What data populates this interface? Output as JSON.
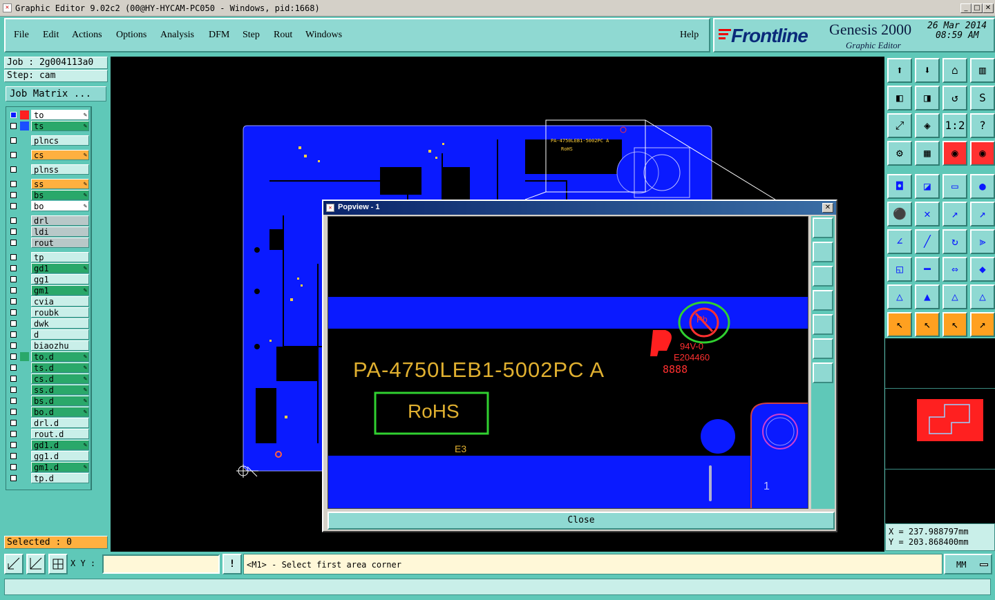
{
  "window": {
    "title": "Graphic Editor 9.02c2 (00@HY-HYCAM-PC050 - Windows, pid:1668)"
  },
  "menu": {
    "items": [
      "File",
      "Edit",
      "Actions",
      "Options",
      "Analysis",
      "DFM",
      "Step",
      "Rout",
      "Windows"
    ],
    "help": "Help"
  },
  "brand": {
    "logo": "Frontline",
    "product": "Genesis 2000",
    "subtitle": "Graphic Editor",
    "date": "26 Mar 2014",
    "time": "08:59 AM"
  },
  "job": {
    "job_label": "Job : 2g004113a0",
    "step_label": "Step: cam",
    "matrix_button": "Job Matrix ..."
  },
  "layers": [
    {
      "name": "to",
      "color": "#ffffff",
      "swatch": "#ff2020",
      "edit": true,
      "group": 0
    },
    {
      "name": "ts",
      "color": "#2aa86a",
      "swatch": "#1a4fff",
      "edit": true,
      "group": 0
    },
    {
      "name": "plncs",
      "color": "#c9efe9",
      "swatch": "",
      "edit": false,
      "group": 1
    },
    {
      "name": "cs",
      "color": "#ffb040",
      "swatch": "",
      "edit": true,
      "group": 2
    },
    {
      "name": "plnss",
      "color": "#c9efe9",
      "swatch": "",
      "edit": false,
      "group": 3
    },
    {
      "name": "ss",
      "color": "#ffb040",
      "swatch": "",
      "edit": true,
      "group": 4
    },
    {
      "name": "bs",
      "color": "#2aa86a",
      "swatch": "",
      "edit": true,
      "group": 4
    },
    {
      "name": "bo",
      "color": "#ffffff",
      "swatch": "",
      "edit": true,
      "group": 4
    },
    {
      "name": "drl",
      "color": "#b8c8c8",
      "swatch": "",
      "edit": false,
      "group": 5
    },
    {
      "name": "ldi",
      "color": "#b8c8c8",
      "swatch": "",
      "edit": false,
      "group": 5
    },
    {
      "name": "rout",
      "color": "#b8c8c8",
      "swatch": "",
      "edit": false,
      "group": 5
    },
    {
      "name": "tp",
      "color": "#c9efe9",
      "swatch": "",
      "edit": false,
      "group": 6
    },
    {
      "name": "gd1",
      "color": "#2aa86a",
      "swatch": "",
      "edit": true,
      "group": 6
    },
    {
      "name": "gg1",
      "color": "#c9efe9",
      "swatch": "",
      "edit": false,
      "group": 6
    },
    {
      "name": "gm1",
      "color": "#2aa86a",
      "swatch": "",
      "edit": true,
      "group": 6
    },
    {
      "name": "cvia",
      "color": "#c9efe9",
      "swatch": "",
      "edit": false,
      "group": 6
    },
    {
      "name": "roubk",
      "color": "#c9efe9",
      "swatch": "",
      "edit": false,
      "group": 6
    },
    {
      "name": "dwk",
      "color": "#c9efe9",
      "swatch": "",
      "edit": false,
      "group": 6
    },
    {
      "name": "d",
      "color": "#c9efe9",
      "swatch": "",
      "edit": false,
      "group": 6
    },
    {
      "name": "biaozhu",
      "color": "#c9efe9",
      "swatch": "",
      "edit": false,
      "group": 6
    },
    {
      "name": "to.d",
      "color": "#2aa86a",
      "swatch": "#2aa86a",
      "edit": true,
      "group": 6
    },
    {
      "name": "ts.d",
      "color": "#2aa86a",
      "swatch": "",
      "edit": true,
      "group": 6
    },
    {
      "name": "cs.d",
      "color": "#2aa86a",
      "swatch": "",
      "edit": true,
      "group": 6
    },
    {
      "name": "ss.d",
      "color": "#2aa86a",
      "swatch": "",
      "edit": true,
      "group": 6
    },
    {
      "name": "bs.d",
      "color": "#2aa86a",
      "swatch": "",
      "edit": true,
      "group": 6
    },
    {
      "name": "bo.d",
      "color": "#2aa86a",
      "swatch": "",
      "edit": true,
      "group": 6
    },
    {
      "name": "drl.d",
      "color": "#c9efe9",
      "swatch": "",
      "edit": false,
      "group": 6
    },
    {
      "name": "rout.d",
      "color": "#c9efe9",
      "swatch": "",
      "edit": false,
      "group": 6
    },
    {
      "name": "gd1.d",
      "color": "#2aa86a",
      "swatch": "",
      "edit": true,
      "group": 6
    },
    {
      "name": "gg1.d",
      "color": "#c9efe9",
      "swatch": "",
      "edit": false,
      "group": 6
    },
    {
      "name": "gm1.d",
      "color": "#2aa86a",
      "swatch": "",
      "edit": true,
      "group": 6
    },
    {
      "name": "tp.d",
      "color": "#c9efe9",
      "swatch": "",
      "edit": false,
      "group": 6
    }
  ],
  "selected": "Selected : 0",
  "popview": {
    "title": "Popview - 1",
    "close_button": "Close",
    "part_label": "PA-4750LEB1-5002PC A",
    "rohs": "RoHS",
    "e3": "E3",
    "ul_rating": "94V-0",
    "ul_file": "E204460",
    "date_code": "8888",
    "pb": "Pb",
    "pin": "1"
  },
  "board_silk": {
    "part": "PA-4750LEB1-5002PC A",
    "rohs": "RoHS"
  },
  "coords": {
    "x": "X = 237.988797mm",
    "y": "Y = 203.868400mm"
  },
  "command": {
    "xy_label": "X Y :",
    "xy_value": "",
    "prompt": "<M1> - Select first area corner",
    "units": "MM"
  },
  "colors": {
    "board": "#0a1aff",
    "background": "#000000",
    "panel": "#5fc8b8",
    "accent": "#8fd9d2"
  }
}
